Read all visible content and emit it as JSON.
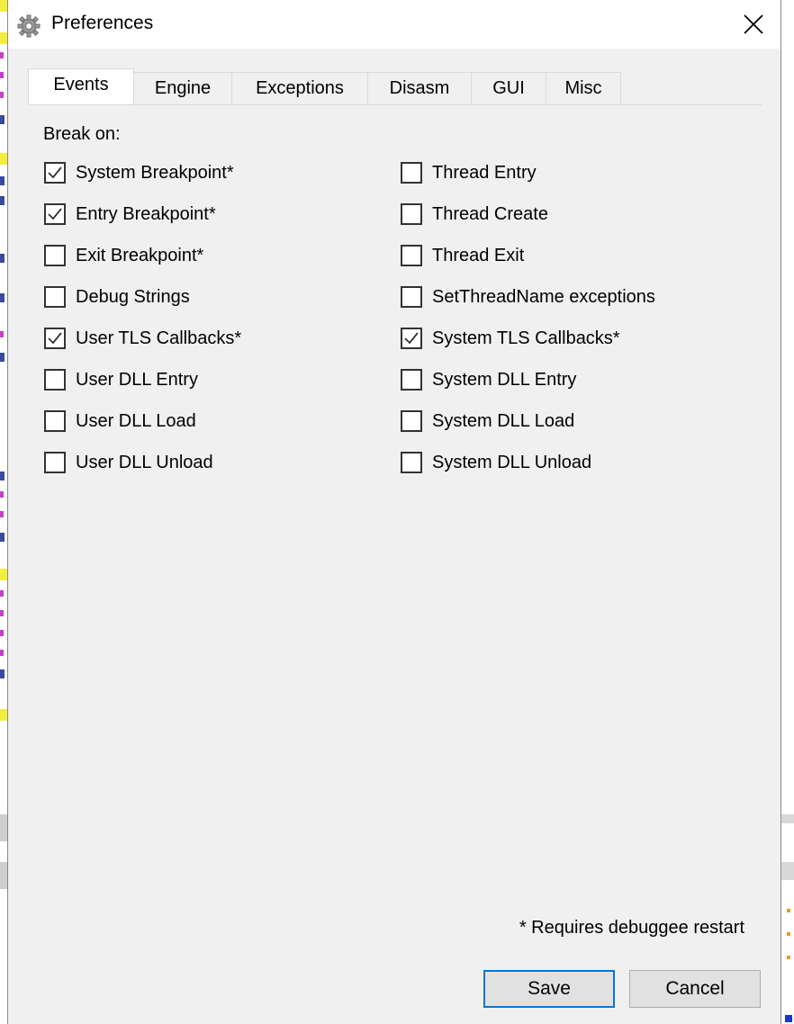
{
  "window": {
    "title": "Preferences",
    "icon": "gear-icon",
    "close_icon": "close-icon"
  },
  "tabs": [
    {
      "label": "Events",
      "active": true
    },
    {
      "label": "Engine",
      "active": false
    },
    {
      "label": "Exceptions",
      "active": false
    },
    {
      "label": "Disasm",
      "active": false
    },
    {
      "label": "GUI",
      "active": false
    },
    {
      "label": "Misc",
      "active": false
    }
  ],
  "events": {
    "heading": "Break on:",
    "left_column": [
      {
        "label": "System Breakpoint*",
        "checked": true
      },
      {
        "label": "Entry Breakpoint*",
        "checked": true
      },
      {
        "label": "Exit Breakpoint*",
        "checked": false
      },
      {
        "label": "Debug Strings",
        "checked": false
      },
      {
        "label": "User TLS Callbacks*",
        "checked": true
      },
      {
        "label": "User DLL Entry",
        "checked": false
      },
      {
        "label": "User DLL Load",
        "checked": false
      },
      {
        "label": "User DLL Unload",
        "checked": false
      }
    ],
    "right_column": [
      {
        "label": "Thread Entry",
        "checked": false
      },
      {
        "label": "Thread Create",
        "checked": false
      },
      {
        "label": "Thread Exit",
        "checked": false
      },
      {
        "label": "SetThreadName exceptions",
        "checked": false
      },
      {
        "label": "System TLS Callbacks*",
        "checked": true
      },
      {
        "label": "System DLL Entry",
        "checked": false
      },
      {
        "label": "System DLL Load",
        "checked": false
      },
      {
        "label": "System DLL Unload",
        "checked": false
      }
    ]
  },
  "footer": {
    "note": "* Requires debuggee restart",
    "save_label": "Save",
    "cancel_label": "Cancel"
  },
  "colors": {
    "dialog_background": "#f0f0f0",
    "default_button_border": "#0078d7",
    "checkbox_border": "#333333"
  }
}
